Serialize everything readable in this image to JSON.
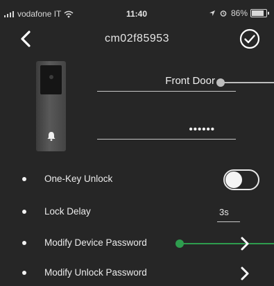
{
  "status_bar": {
    "carrier": "vodafone IT",
    "time": "11:40",
    "battery_text": "86%",
    "battery_level": 0.86,
    "icons": [
      "signal-icon",
      "wifi-icon",
      "location-arrow-icon",
      "alarm-icon",
      "battery-icon"
    ]
  },
  "nav": {
    "title": "cm02f85953",
    "back_icon": "chevron-left-icon",
    "done_icon": "check-circle-icon"
  },
  "device": {
    "name": "Front Door",
    "password_masked": "••••••",
    "image_icons": [
      "camera-icon",
      "bell-icon"
    ]
  },
  "settings": [
    {
      "label": "One-Key Unlock",
      "control": "toggle",
      "enabled": false
    },
    {
      "label": "Lock Delay",
      "control": "value",
      "value": "3s"
    },
    {
      "label": "Modify Device Password",
      "control": "chevron",
      "icon": "chevron-right-icon"
    },
    {
      "label": "Modify Unlock Password",
      "control": "chevron",
      "icon": "chevron-right-icon"
    }
  ],
  "colors": {
    "background": "#262626",
    "annotation_gray": "#bdbdbd",
    "annotation_green": "#2e9d4e",
    "text": "#f2f2f2"
  }
}
